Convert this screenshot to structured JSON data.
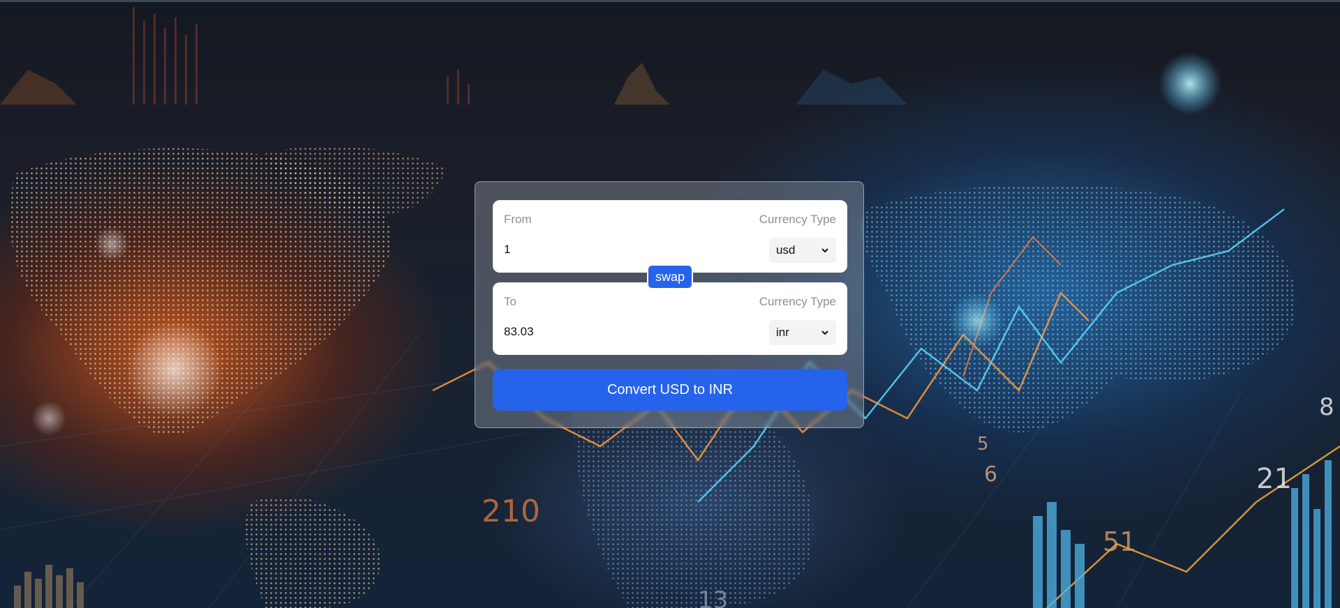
{
  "converter": {
    "from": {
      "label": "From",
      "currency_label": "Currency Type",
      "amount": "1",
      "currency": "usd"
    },
    "to": {
      "label": "To",
      "currency_label": "Currency Type",
      "amount": "83.03",
      "currency": "inr"
    },
    "swap_label": "swap",
    "convert_label": "Convert USD to INR"
  },
  "background": {
    "numbers": [
      "210",
      "51",
      "21",
      "6",
      "5",
      "13",
      "8"
    ]
  },
  "colors": {
    "accent": "#2563eb",
    "card_bg": "rgba(160,165,175,0.38)",
    "label": "#8a8f98"
  }
}
